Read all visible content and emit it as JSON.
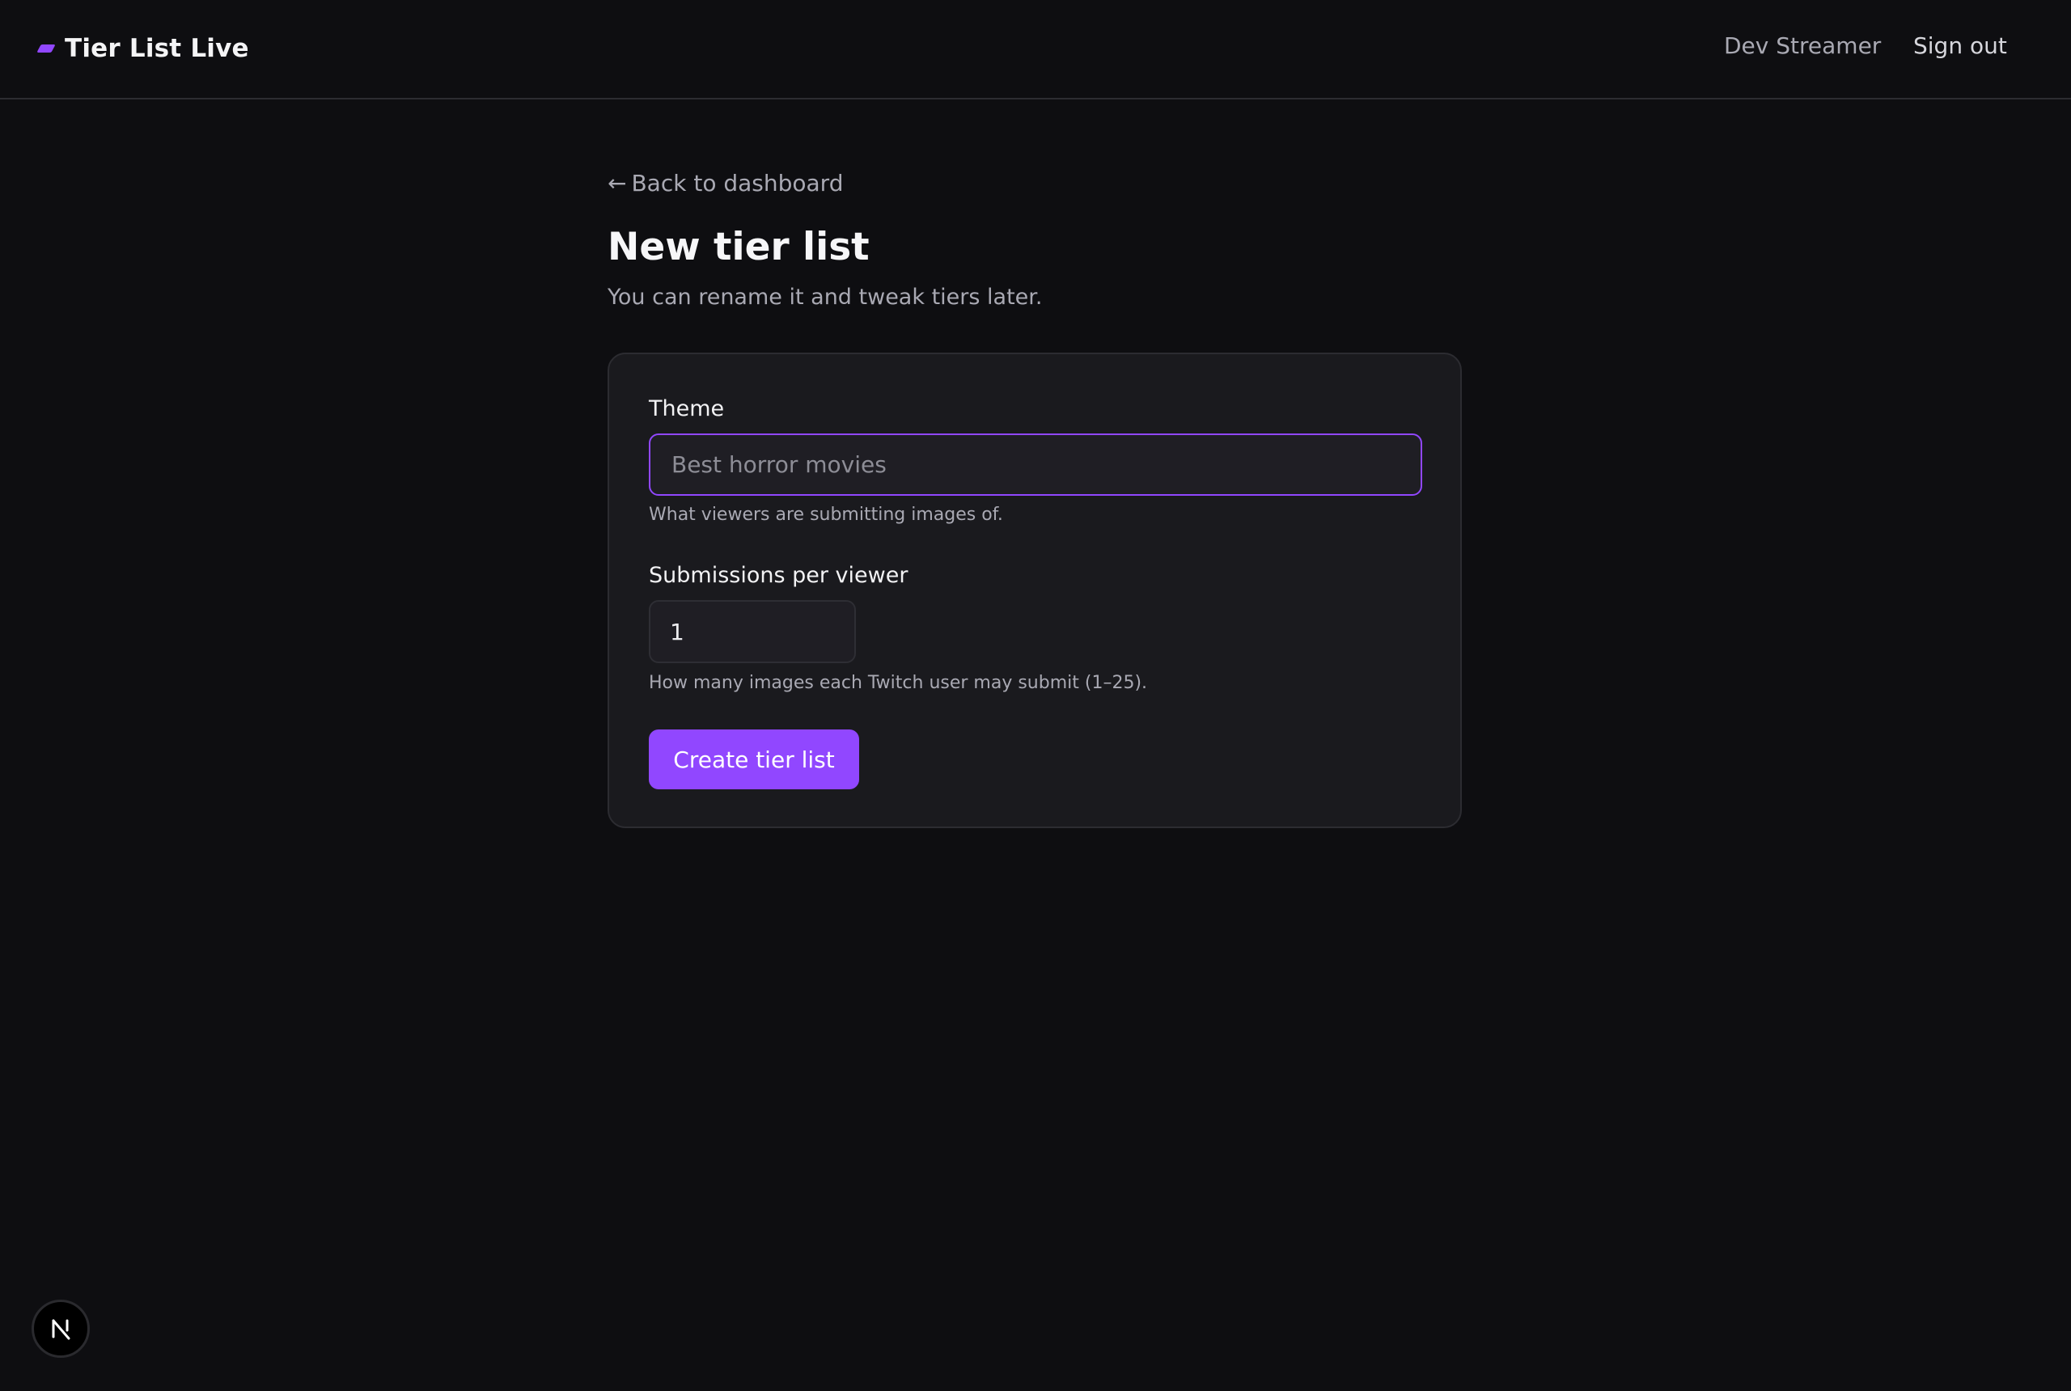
{
  "header": {
    "brand": "Tier List Live",
    "user_name": "Dev Streamer",
    "sign_out_label": "Sign out"
  },
  "back_link": {
    "arrow": "←",
    "label": "Back to dashboard"
  },
  "page": {
    "title": "New tier list",
    "subtitle": "You can rename it and tweak tiers later."
  },
  "form": {
    "theme": {
      "label": "Theme",
      "value": "",
      "placeholder": "Best horror movies",
      "help": "What viewers are submitting images of."
    },
    "submissions": {
      "label": "Submissions per viewer",
      "value": "1",
      "help": "How many images each Twitch user may submit (1–25)."
    },
    "submit_label": "Create tier list"
  },
  "colors": {
    "accent": "#9147ff",
    "background": "#0e0e11",
    "card": "#1a1a1e"
  },
  "icons": {
    "brand": "brand-mark-icon",
    "back": "arrow-left-icon",
    "dev_badge": "nextjs-logo-icon"
  }
}
